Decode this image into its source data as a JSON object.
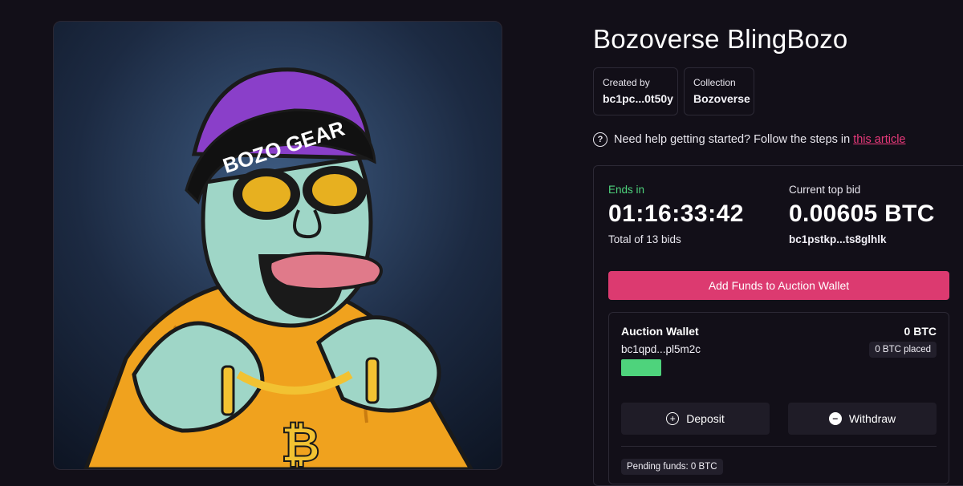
{
  "nft": {
    "title": "Bozoverse BlingBozo",
    "image_alt": "BlingBozo artwork",
    "beanie_text": "BOZO GEAR",
    "pendant_symbol": "₿"
  },
  "meta": {
    "created_by_label": "Created by",
    "created_by_value": "bc1pc...0t50y",
    "collection_label": "Collection",
    "collection_value": "Bozoverse"
  },
  "help": {
    "text": "Need help getting started? Follow the steps in",
    "link_text": "this article"
  },
  "auction": {
    "ends_label": "Ends in",
    "ends_value": "01:16:33:42",
    "bids_text": "Total of 13 bids",
    "top_bid_label": "Current top bid",
    "top_bid_value": "0.00605 BTC",
    "top_bid_address": "bc1pstkp...ts8glhlk",
    "add_funds_label": "Add Funds to Auction Wallet"
  },
  "wallet": {
    "title": "Auction Wallet",
    "address": "bc1qpd...pl5m2c",
    "balance": "0 BTC",
    "placed": "0 BTC placed",
    "deposit_label": "Deposit",
    "withdraw_label": "Withdraw",
    "pending": "Pending funds: 0 BTC"
  },
  "colors": {
    "background": "#120f18",
    "accent_pink": "#dc3a70",
    "accent_green": "#4ed37c",
    "panel_border": "#2c2935"
  },
  "icons": [
    "question-circle-icon",
    "plus-circle-icon",
    "minus-circle-icon"
  ]
}
